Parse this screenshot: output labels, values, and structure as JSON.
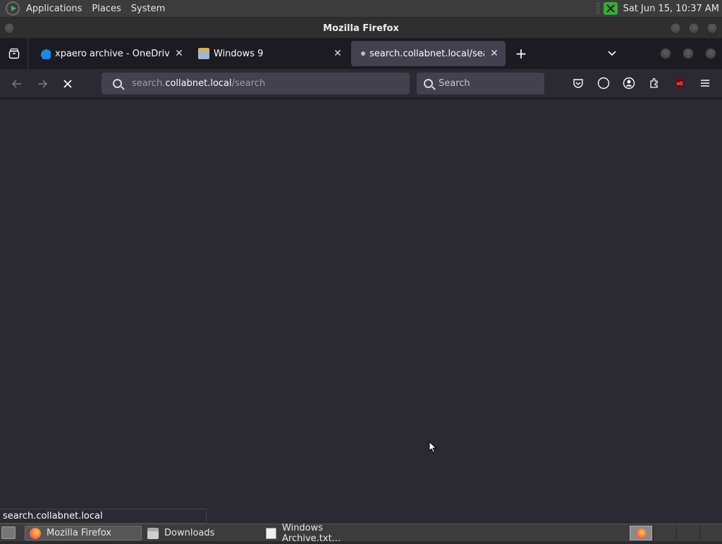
{
  "system_panel": {
    "menus": [
      "Applications",
      "Places",
      "System"
    ],
    "clock": "Sat Jun 15, 10:37 AM"
  },
  "window": {
    "title": "Mozilla Firefox"
  },
  "tabs": [
    {
      "title": "xpaero archive - OneDrive",
      "favicon": "onedrive-cloud-icon",
      "active": false
    },
    {
      "title": "Windows 9",
      "favicon": "folder-icon",
      "active": false
    },
    {
      "title": "search.collabnet.local/search",
      "favicon": "loading-dot-icon",
      "active": true
    }
  ],
  "navbar": {
    "url_prefix": "search.",
    "url_host": "collabnet.local",
    "url_path": "/search",
    "search_placeholder": "Search"
  },
  "status_tooltip": "search.collabnet.local",
  "taskbar": {
    "items": [
      {
        "label": "Mozilla Firefox",
        "icon": "firefox-icon",
        "active": true
      },
      {
        "label": "Downloads",
        "icon": "folder-icon",
        "active": false
      },
      {
        "label": "Windows Archive.txt...",
        "icon": "text-editor-icon",
        "active": false
      }
    ]
  },
  "colors": {
    "background": "#2b2a33",
    "tabstrip": "#1c1b22",
    "field": "#42414d",
    "panel": "#3c3c3c"
  }
}
